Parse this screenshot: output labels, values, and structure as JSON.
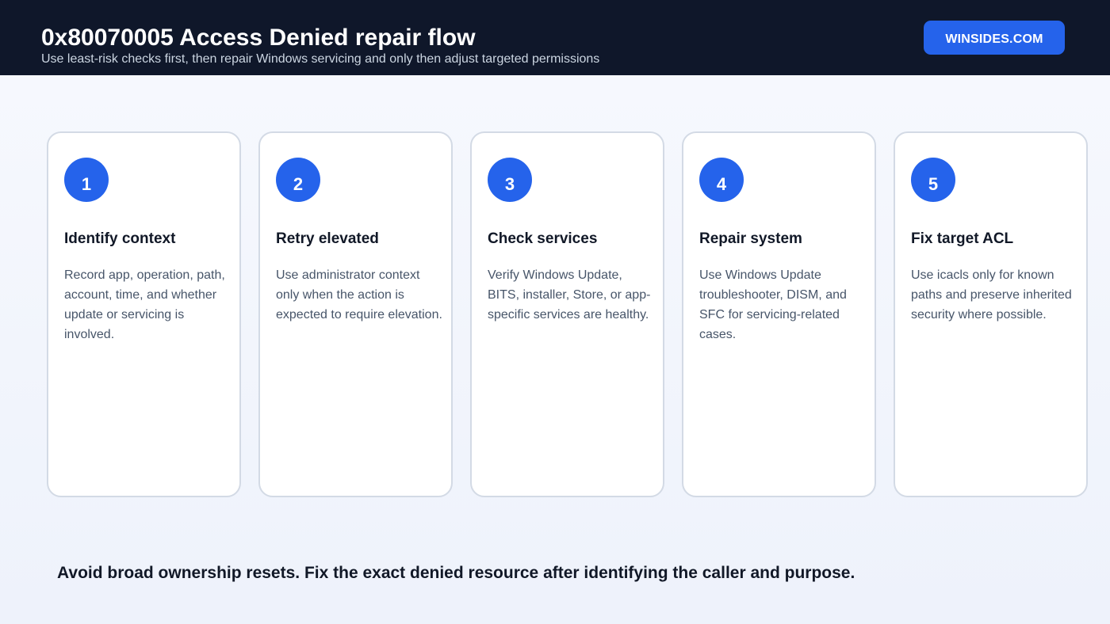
{
  "header": {
    "title": "0x80070005 Access Denied repair flow",
    "subtitle": "Use least-risk checks first, then repair Windows servicing and only then adjust targeted permissions",
    "brand_label": "WINSIDES.COM"
  },
  "steps": [
    {
      "number": "1",
      "title": "Identify context",
      "text": "Record app, operation, path, account, time, and whether update or servicing is involved."
    },
    {
      "number": "2",
      "title": "Retry elevated",
      "text": "Use administrator context only when the action is expected to require elevation."
    },
    {
      "number": "3",
      "title": "Check services",
      "text": "Verify Windows Update, BITS, installer, Store, or app-specific services are healthy."
    },
    {
      "number": "4",
      "title": "Repair system",
      "text": "Use Windows Update troubleshooter, DISM, and SFC for servicing-related cases."
    },
    {
      "number": "5",
      "title": "Fix target ACL",
      "text": "Use icacls only for known paths and preserve inherited security where possible."
    }
  ],
  "footer": {
    "note": "Avoid broad ownership resets. Fix the exact denied resource after identifying the caller and purpose."
  },
  "colors": {
    "header_bg": "#0f172a",
    "accent": "#2563eb",
    "card_border": "#d3dae5"
  }
}
